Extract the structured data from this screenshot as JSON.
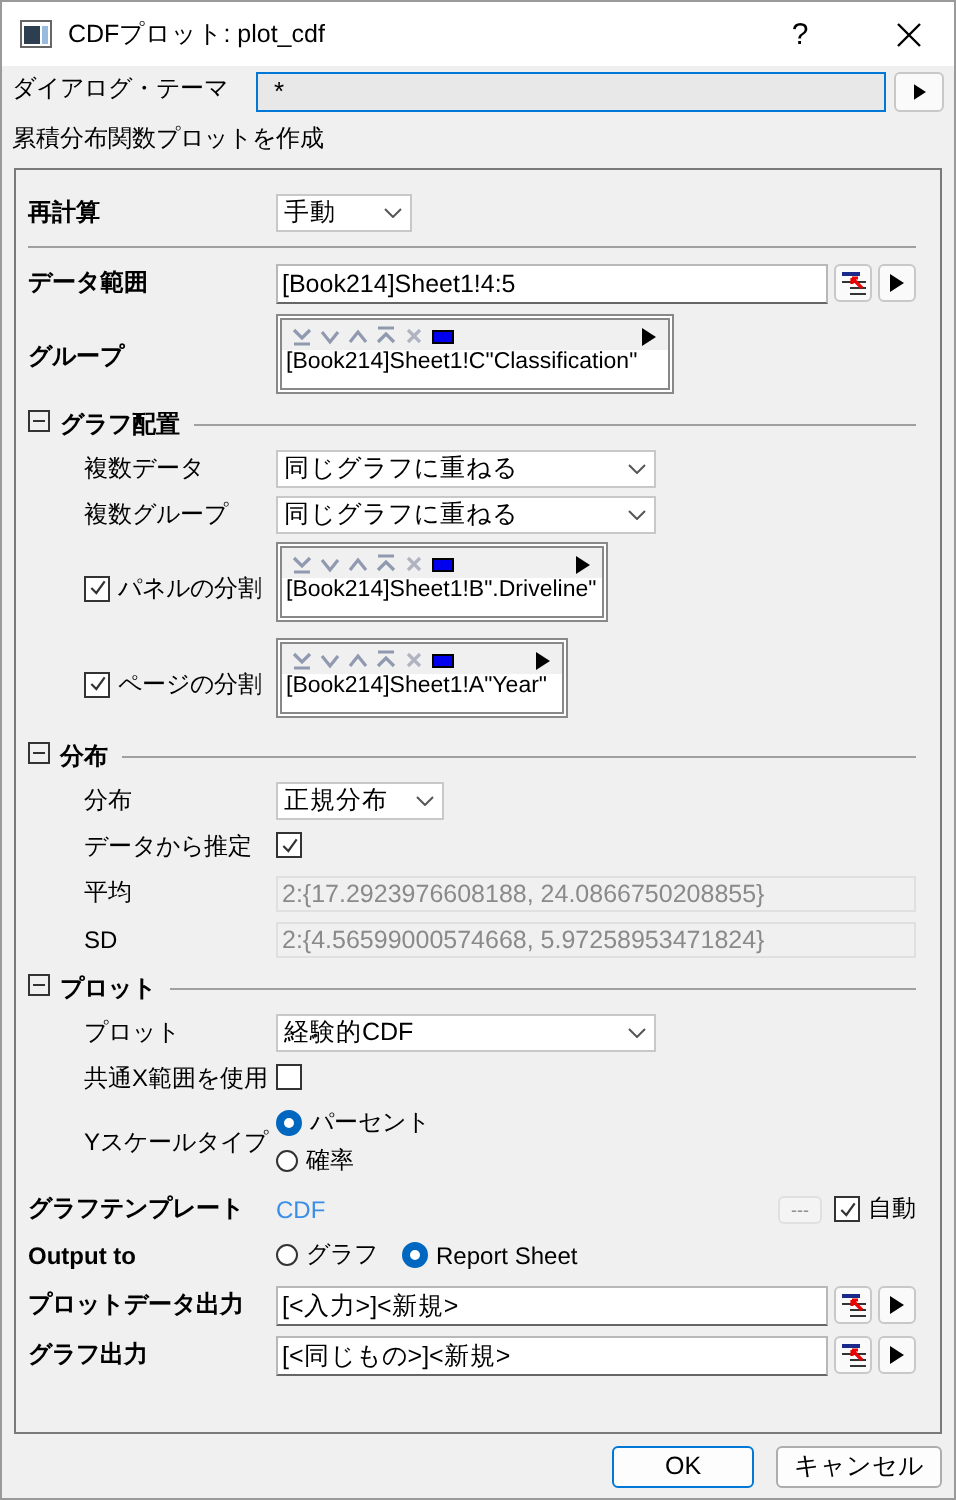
{
  "window": {
    "title": "CDFプロット: plot_cdf",
    "help_button": "?"
  },
  "theme": {
    "label": "ダイアログ・テーマ",
    "value": "*"
  },
  "description": "累積分布関数プロットを作成",
  "items": [
    {
      "kind": "combo",
      "label": "再計算",
      "value": "手動",
      "divider": true
    },
    {
      "kind": "range",
      "label": "データ範囲",
      "value": "[Book214]Sheet1!4:5"
    },
    {
      "kind": "list",
      "label": "グループ",
      "value": "[Book214]Sheet1!C\"Classification\""
    },
    {
      "kind": "section",
      "label": "グラフ配置",
      "expanded": true,
      "children": [
        {
          "kind": "combo",
          "label": "複数データ",
          "value": "同じグラフに重ねる"
        },
        {
          "kind": "combo",
          "label": "複数グループ",
          "value": "同じグラフに重ねる"
        },
        {
          "kind": "check-list",
          "label": "パネルの分割",
          "checked": true,
          "value": "[Book214]Sheet1!B\".Driveline\""
        },
        {
          "kind": "check-list",
          "label": "ページの分割",
          "checked": true,
          "value": "[Book214]Sheet1!A\"Year\""
        }
      ]
    },
    {
      "kind": "section",
      "label": "分布",
      "expanded": true,
      "children": [
        {
          "kind": "combo",
          "label": "分布",
          "value": "正規分布"
        },
        {
          "kind": "checkbox",
          "label": "データから推定",
          "checked": true
        },
        {
          "kind": "field",
          "label": "平均",
          "value": "2:{17.2923976608188, 24.0866750208855}",
          "disabled": true
        },
        {
          "kind": "field",
          "label": "SD",
          "value": "2:{4.56599000574668, 5.97258953471824}",
          "disabled": true
        }
      ]
    },
    {
      "kind": "section",
      "label": "プロット",
      "expanded": true,
      "children": [
        {
          "kind": "combo",
          "label": "プロット",
          "value": "経験的CDF"
        },
        {
          "kind": "checkbox",
          "label": "共通X範囲を使用",
          "checked": false
        },
        {
          "kind": "radio-stack",
          "label": "Yスケールタイプ",
          "options": [
            {
              "label": "パーセント",
              "selected": true
            },
            {
              "label": "確率",
              "selected": false
            }
          ]
        }
      ]
    },
    {
      "kind": "template",
      "label": "グラフテンプレート",
      "value": "CDF",
      "button": "---",
      "option": {
        "label": "自動",
        "checked": true
      }
    },
    {
      "kind": "radio-row",
      "label": "Output to",
      "options": [
        {
          "label": "グラフ",
          "selected": false
        },
        {
          "label": "Report Sheet",
          "selected": true
        }
      ]
    },
    {
      "kind": "range",
      "label": "プロットデータ出力",
      "value": "[<入力>]<新規>"
    },
    {
      "kind": "range",
      "label": "グラフ出力",
      "value": "[<同じもの>]<新規>"
    }
  ],
  "buttons": [
    {
      "label": "OK",
      "default": true
    },
    {
      "label": "キャンセル",
      "default": false
    }
  ]
}
